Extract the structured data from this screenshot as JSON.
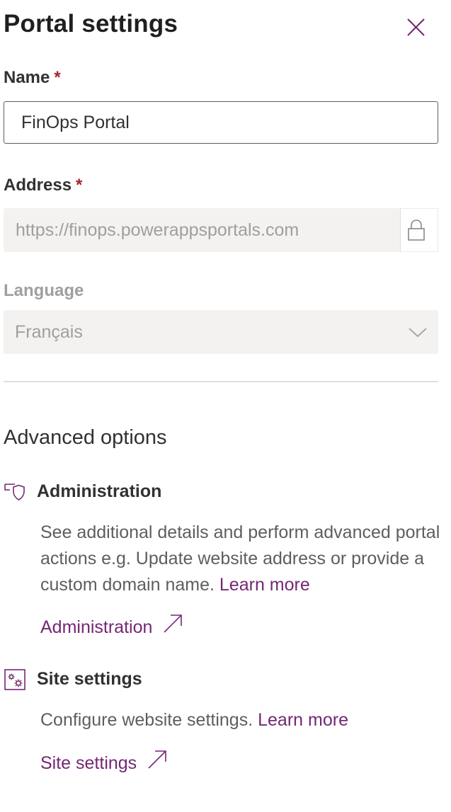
{
  "panel": {
    "title": "Portal settings",
    "close_icon": "close-icon"
  },
  "name_field": {
    "label": "Name",
    "required_marker": "*",
    "value": "FinOps Portal"
  },
  "address_field": {
    "label": "Address",
    "required_marker": "*",
    "value": "https://finops.powerappsportals.com",
    "icon": "lock-icon"
  },
  "language_field": {
    "label": "Language",
    "selected": "Français",
    "icon": "chevron-down-icon"
  },
  "advanced": {
    "title": "Advanced options",
    "administration": {
      "title": "Administration",
      "icon": "admin-shield-icon",
      "description": "See additional details and perform advanced portal actions e.g. Update website address or provide a custom domain name.",
      "learn_more": "Learn more",
      "link_label": "Administration",
      "link_icon": "open-external-icon"
    },
    "site_settings": {
      "title": "Site settings",
      "icon": "settings-gears-icon",
      "description": "Configure website settings.",
      "learn_more": "Learn more",
      "link_label": "Site settings",
      "link_icon": "open-external-icon"
    }
  },
  "colors": {
    "accent": "#742774",
    "required": "#a4262c",
    "text": "#323130",
    "muted": "#a19f9d",
    "disabled_bg": "#f3f2f1"
  }
}
